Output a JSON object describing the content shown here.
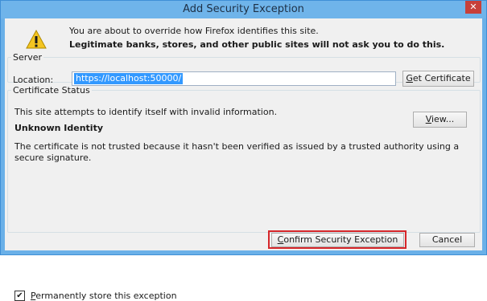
{
  "window": {
    "title": "Add Security Exception",
    "close_glyph": "✕"
  },
  "header": {
    "line1": "You are about to override how Firefox identifies this site.",
    "line2": "Legitimate banks, stores, and other public sites will not ask you to do this."
  },
  "server": {
    "legend": "Server",
    "location_label": "Location:",
    "location_value": "https://localhost:50000/",
    "get_certificate_first": "G",
    "get_certificate_rest": "et Certificate"
  },
  "status": {
    "legend": "Certificate Status",
    "summary": "This site attempts to identify itself with invalid information.",
    "identity_title": "Unknown Identity",
    "description": "The certificate is not trusted because it hasn't been verified as issued by a trusted authority using a secure signature.",
    "view_first": "V",
    "view_rest": "iew..."
  },
  "permanent": {
    "checked": true,
    "label_first": "P",
    "label_rest": "ermanently store this exception"
  },
  "buttons": {
    "confirm_first": "C",
    "confirm_rest": "onfirm Security Exception",
    "cancel": "Cancel"
  },
  "colors": {
    "titlebar": "#6fb4ea",
    "close": "#c7403a",
    "highlight": "#d6262a",
    "selection": "#3399ff"
  }
}
